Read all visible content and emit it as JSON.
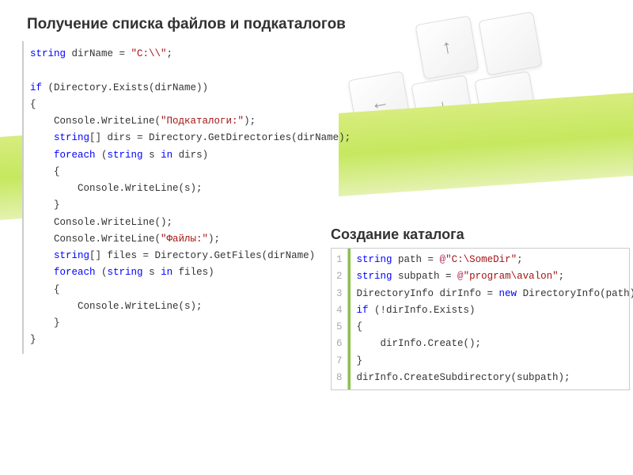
{
  "heading1": "Получение списка файлов и подкаталогов",
  "heading2": "Создание каталога",
  "code1": {
    "l1a": "string",
    "l1b": " dirName = ",
    "l1c": "\"C:\\\\\"",
    "l1d": ";",
    "l2": "",
    "l3a": "if",
    "l3b": " (Directory.Exists(dirName))",
    "l4": "{",
    "l5a": "    Console.WriteLine(",
    "l5b": "\"Подкаталоги:\"",
    "l5c": ");",
    "l6a": "    ",
    "l6b": "string",
    "l6c": "[] dirs = Directory.GetDirectories(dirName);",
    "l7a": "    ",
    "l7b": "foreach",
    "l7c": " (",
    "l7d": "string",
    "l7e": " s ",
    "l7f": "in",
    "l7g": " dirs)",
    "l8": "    {",
    "l9": "        Console.WriteLine(s);",
    "l10": "    }",
    "l11": "    Console.WriteLine();",
    "l12a": "    Console.WriteLine(",
    "l12b": "\"Файлы:\"",
    "l12c": ");",
    "l13a": "    ",
    "l13b": "string",
    "l13c": "[] files = Directory.GetFiles(dirName)",
    "l14a": "    ",
    "l14b": "foreach",
    "l14c": " (",
    "l14d": "string",
    "l14e": " s ",
    "l14f": "in",
    "l14g": " files)",
    "l15": "    {",
    "l16": "        Console.WriteLine(s);",
    "l17": "    }",
    "l18": "}"
  },
  "code2": {
    "n1": "1",
    "n2": "2",
    "n3": "3",
    "n4": "4",
    "n5": "5",
    "n6": "6",
    "n7": "7",
    "n8": "8",
    "l1a": "string",
    "l1b": " path = ",
    "l1c": "@",
    "l1d": "\"C:\\SomeDir\"",
    "l1e": ";",
    "l2a": "string",
    "l2b": " subpath = ",
    "l2c": "@",
    "l2d": "\"program\\avalon\"",
    "l2e": ";",
    "l3a": "DirectoryInfo dirInfo = ",
    "l3b": "new",
    "l3c": " DirectoryInfo(path);",
    "l4a": "if",
    "l4b": " (!dirInfo.Exists)",
    "l5": "{",
    "l6": "    dirInfo.Create();",
    "l7": "}",
    "l8": "dirInfo.CreateSubdirectory(subpath);"
  },
  "keys": {
    "left": "←",
    "up": "↑",
    "right": "→",
    "down": "↓"
  }
}
